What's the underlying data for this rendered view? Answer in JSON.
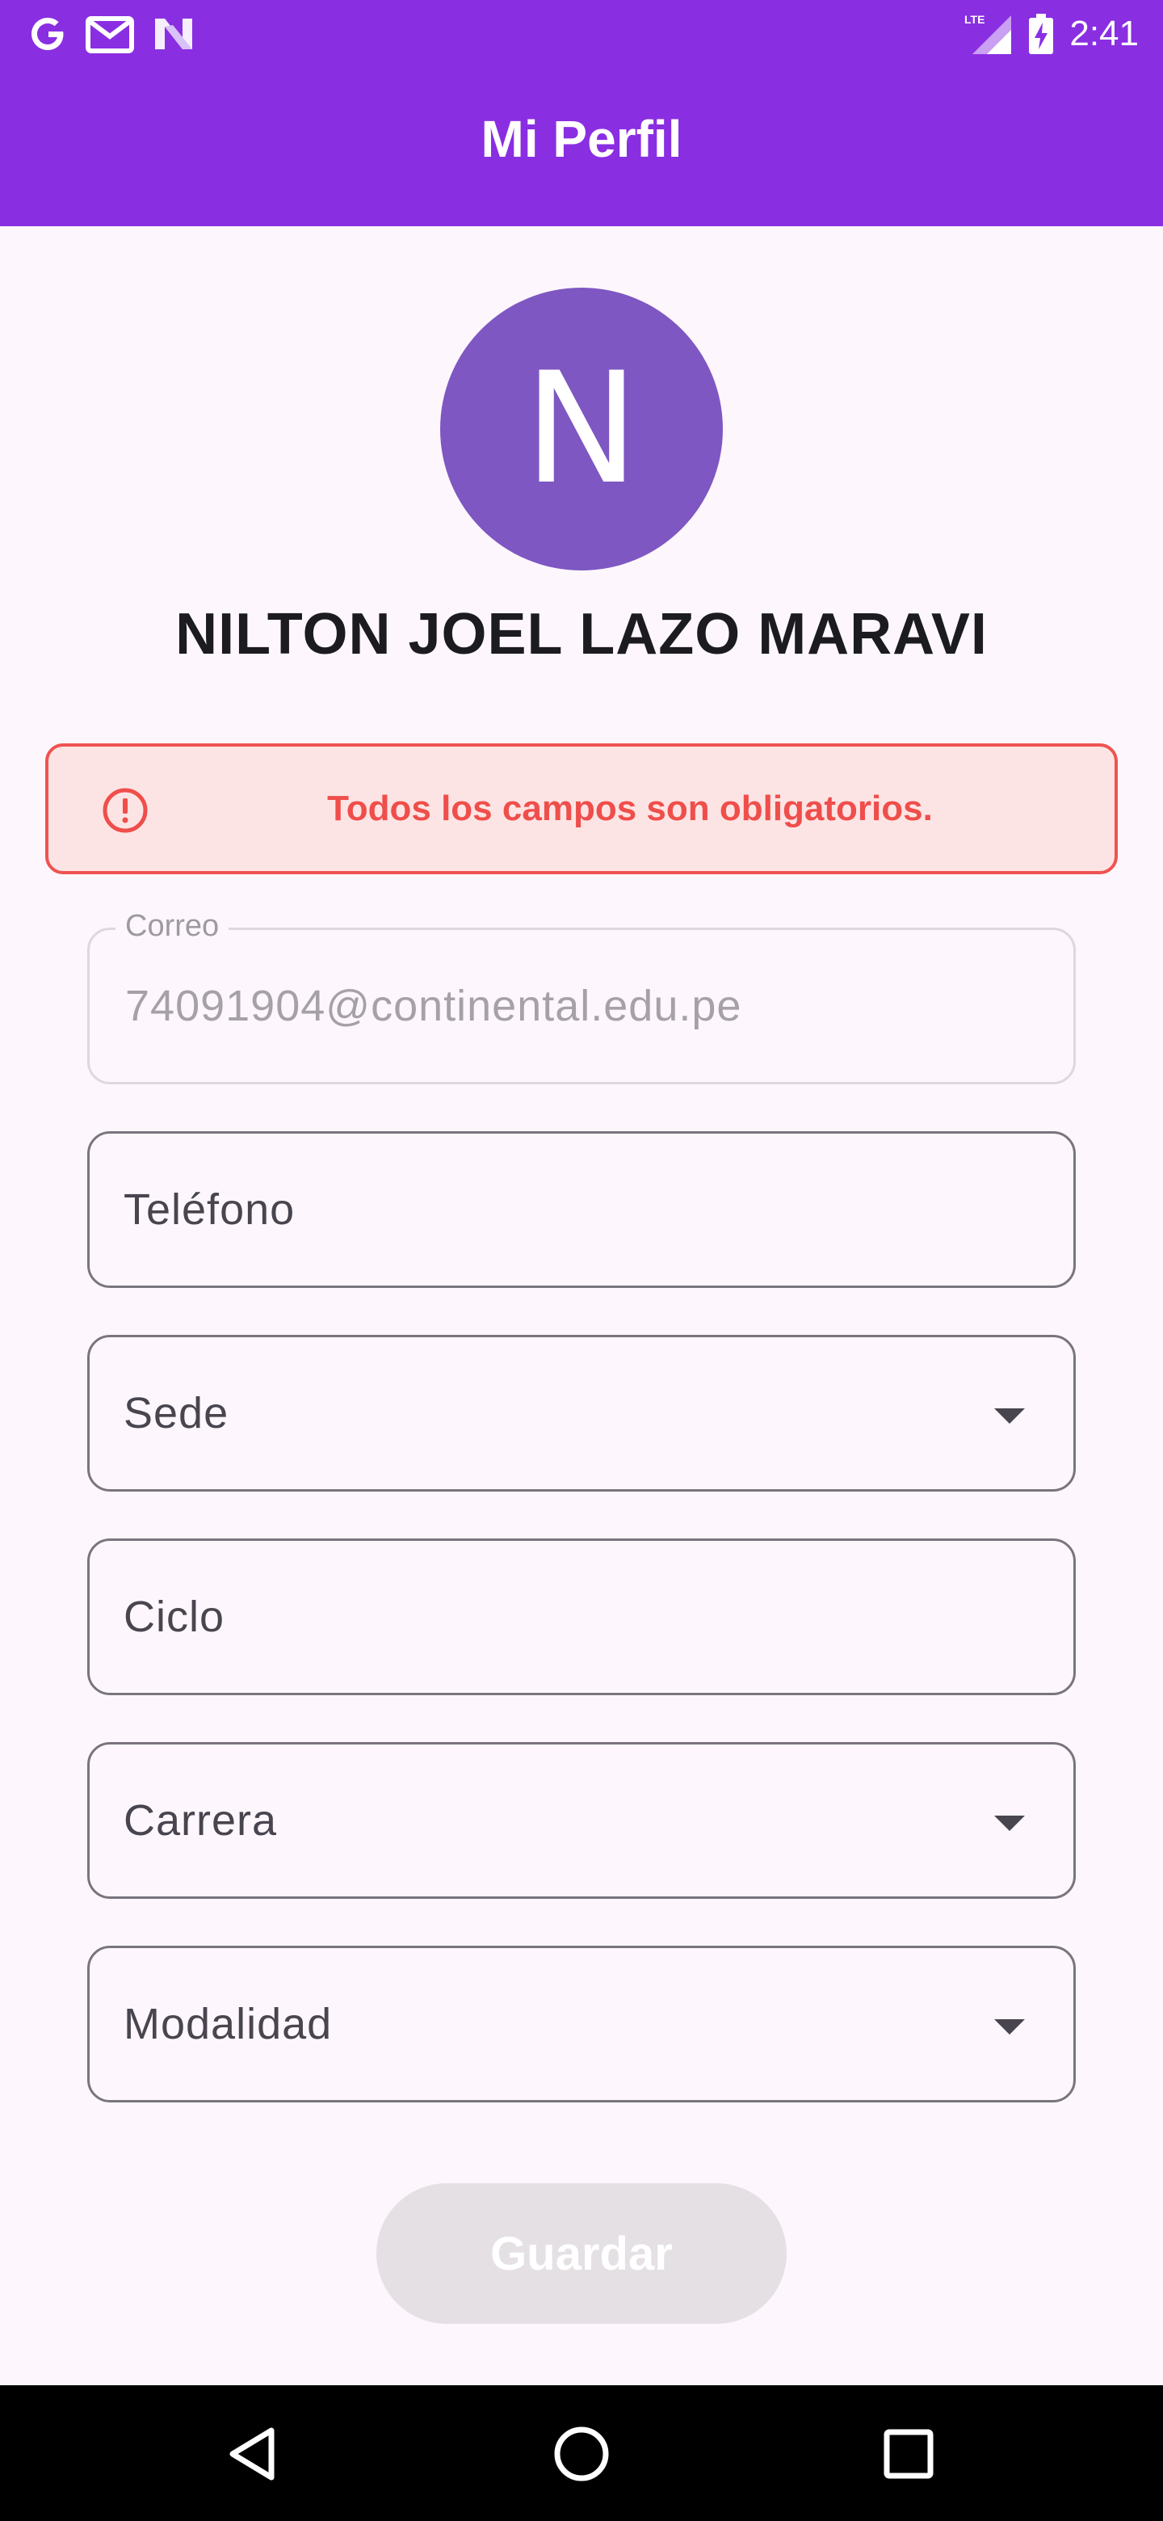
{
  "status_bar": {
    "time": "2:41",
    "icons": [
      "google-icon",
      "gmail-icon",
      "app-n-icon",
      "lte-signal-icon",
      "battery-charging-icon"
    ]
  },
  "app_bar": {
    "title": "Mi Perfil"
  },
  "profile": {
    "avatar_letter": "N",
    "name": "NILTON JOEL LAZO MARAVI"
  },
  "error": {
    "message": "Todos los campos son obligatorios."
  },
  "form": {
    "email": {
      "label": "Correo",
      "value": "74091904@continental.edu.pe"
    },
    "phone": {
      "label": "Teléfono"
    },
    "campus": {
      "label": "Sede"
    },
    "cycle": {
      "label": "Ciclo"
    },
    "career": {
      "label": "Carrera"
    },
    "modality": {
      "label": "Modalidad"
    }
  },
  "actions": {
    "save_label": "Guardar"
  },
  "colors": {
    "primary": "#8a2ee2",
    "avatar": "#7e57c2",
    "error": "#ef5350",
    "error_bg": "#fde4e4",
    "disabled_button": "#e4e0e4"
  },
  "nav": {
    "buttons": [
      "back-icon",
      "home-icon",
      "recents-icon"
    ]
  }
}
